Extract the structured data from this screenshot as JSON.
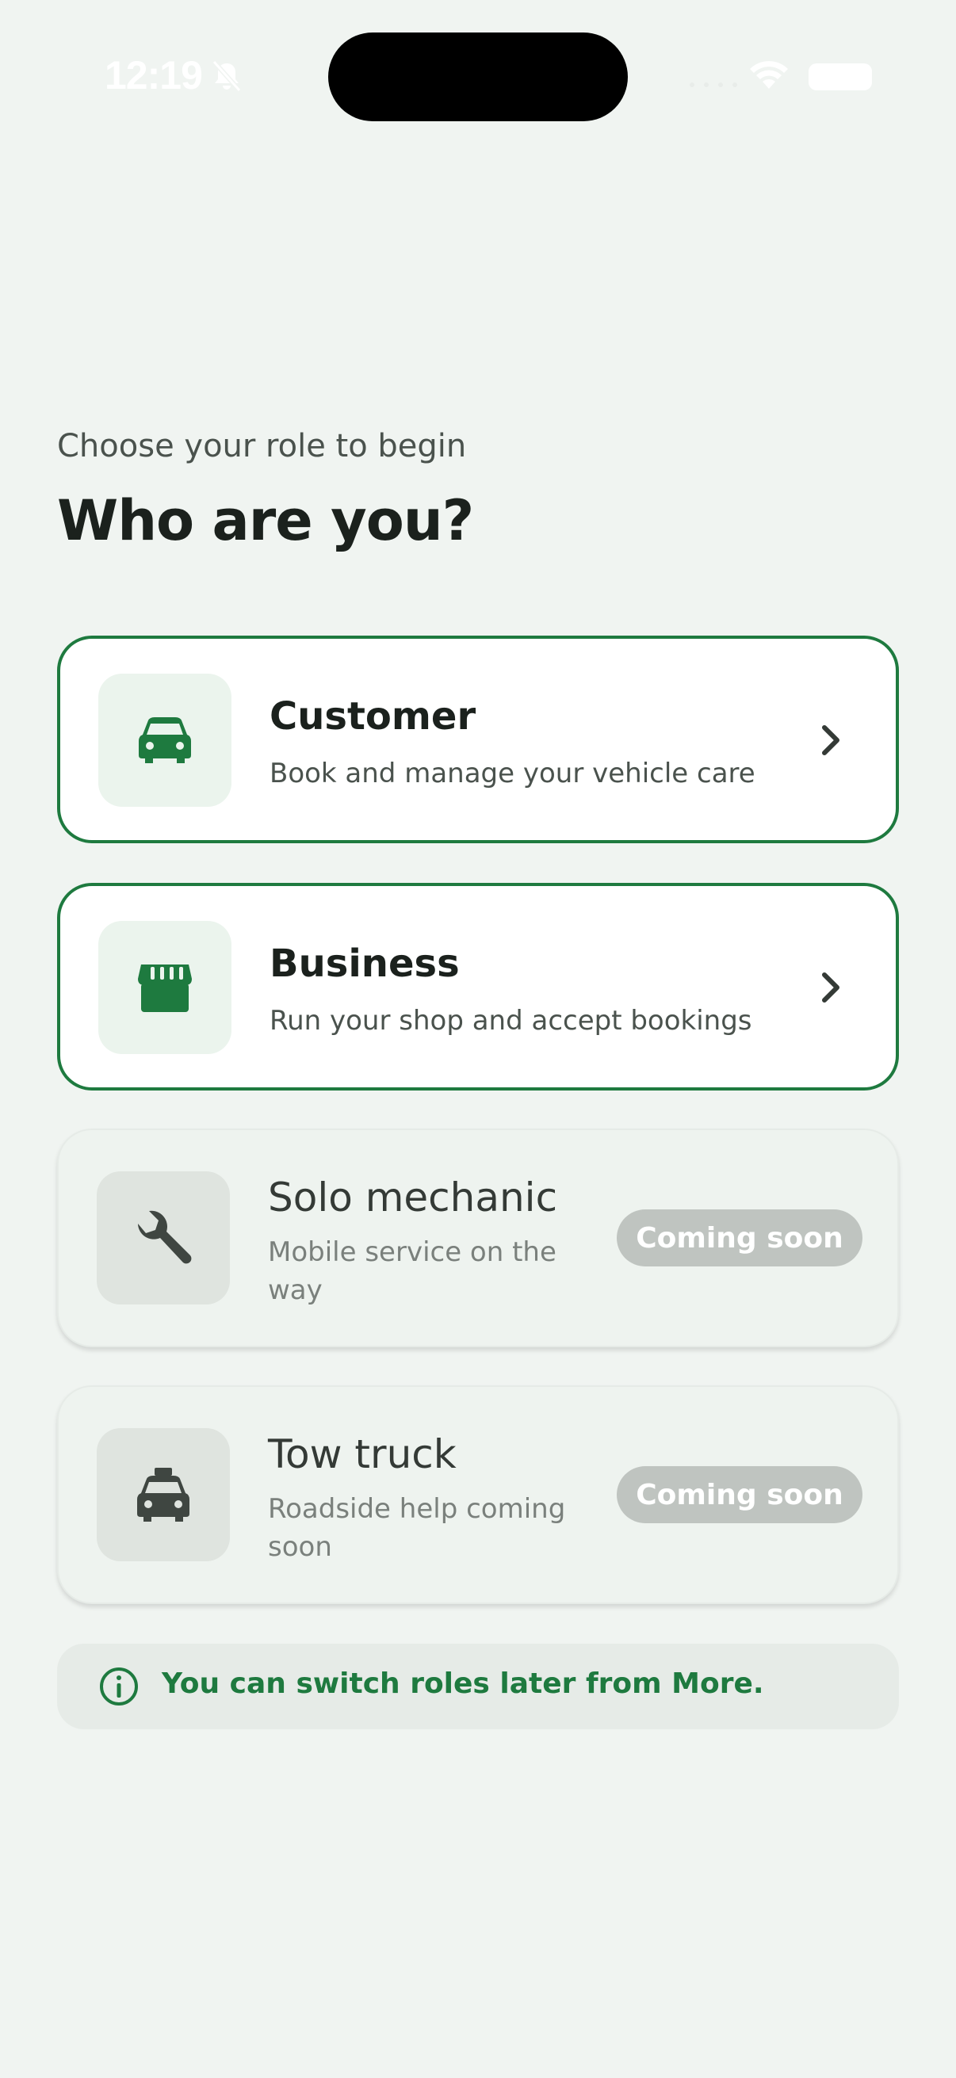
{
  "status_bar": {
    "time": "12:19"
  },
  "header": {
    "subtitle": "Choose your role to begin",
    "title": "Who are you?"
  },
  "roles": [
    {
      "title": "Customer",
      "description": "Book and manage your vehicle care",
      "icon": "car-icon"
    },
    {
      "title": "Business",
      "description": "Run your shop and accept bookings",
      "icon": "storefront-icon"
    },
    {
      "title": "Solo mechanic",
      "description": "Mobile service on the way",
      "icon": "wrench-icon",
      "badge": "Coming soon"
    },
    {
      "title": "Tow truck",
      "description": "Roadside help coming soon",
      "icon": "taxi-icon",
      "badge": "Coming soon"
    }
  ],
  "info": {
    "text": "You can switch roles later from More."
  },
  "colors": {
    "accent": "#1e7a3f",
    "background": "#f0f4f1",
    "badge": "#bfc4c0"
  }
}
